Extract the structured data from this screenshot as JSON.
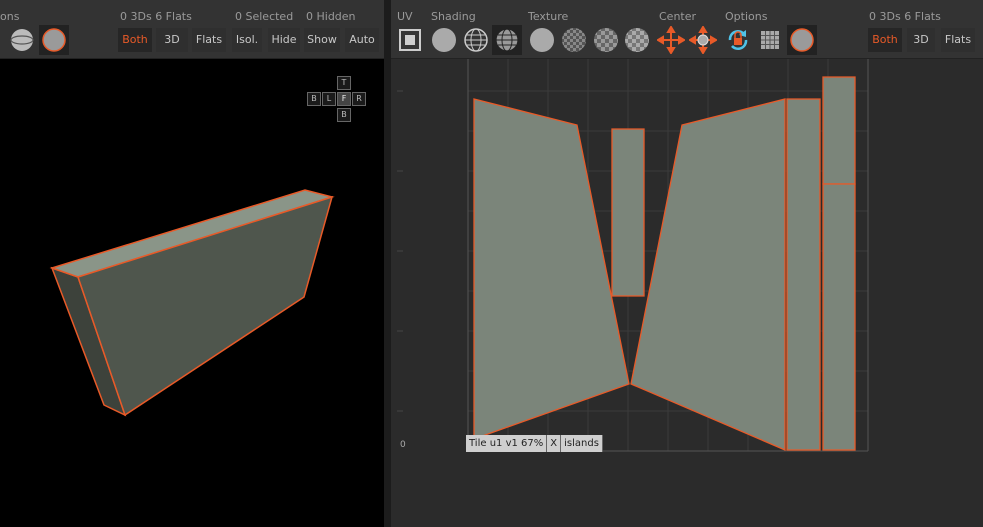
{
  "left_toolbar": {
    "options_label": "ons",
    "counts_label": "0 3Ds 6 Flats",
    "selected_label": "0 Selected",
    "hidden_label": "0 Hidden",
    "buttons": [
      "Both",
      "3D",
      "Flats",
      "Isol.",
      "Hide",
      "Show",
      "Auto"
    ],
    "active_button": "Both"
  },
  "nav_cube": {
    "top": "T",
    "bottom": "B",
    "left": "B",
    "left2": "L",
    "front": "F",
    "right": "R"
  },
  "right_toolbar": {
    "uv_label": "UV",
    "shading_label": "Shading",
    "texture_label": "Texture",
    "center_label": "Center",
    "options_label": "Options",
    "counts_label": "0 3Ds 6 Flats",
    "buttons": [
      "Both",
      "3D",
      "Flats"
    ],
    "active_button": "Both"
  },
  "uv_view": {
    "axis_zero": "0",
    "status": {
      "tile": "Tile u1 v1 67%",
      "close": "X",
      "mode": "islands"
    }
  },
  "colors": {
    "accent": "#e85a28",
    "face": "#7b857a",
    "face_dark": "#4f564d",
    "grid": "#3d3d3d"
  },
  "icons": [
    "sphere-wire-icon",
    "sphere-solid-icon",
    "frame-icon",
    "shading-flat-icon",
    "shading-wire-icon",
    "shading-solid-wire-icon",
    "texture-solid-icon",
    "texture-checker-icon",
    "texture-checker2-icon",
    "texture-checker3-icon",
    "center-move-icon",
    "center-target-icon",
    "refresh-lock-icon",
    "grid-icon",
    "sphere-color-icon"
  ]
}
